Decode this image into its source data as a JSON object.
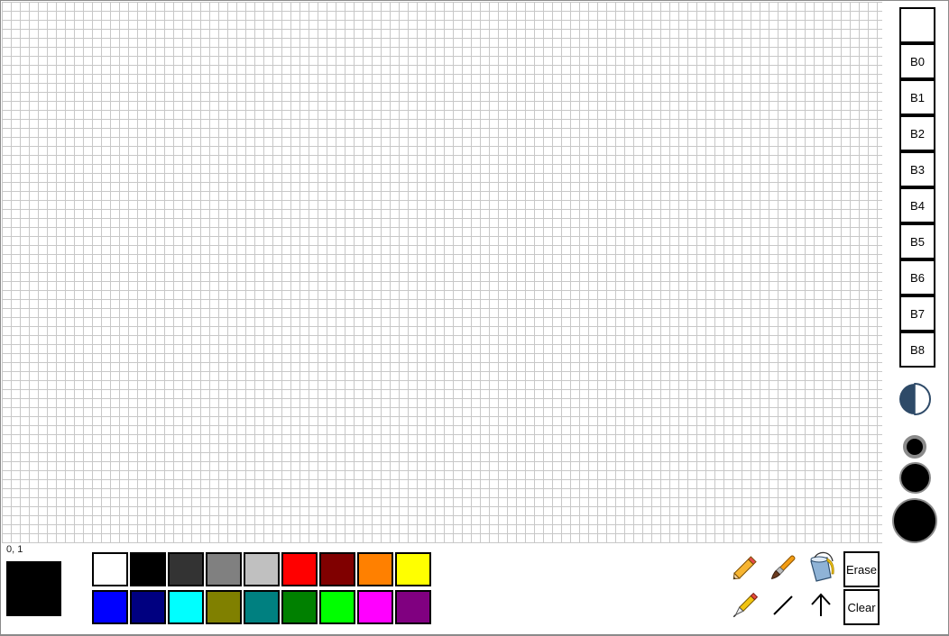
{
  "status": {
    "coords": "0, 1"
  },
  "current_color": "#000000",
  "palette": {
    "row1": [
      "#ffffff",
      "#000000",
      "#333333",
      "#808080",
      "#c0c0c0",
      "#ff0000",
      "#800000",
      "#ff8000",
      "#ffff00"
    ],
    "row2": [
      "#0000ff",
      "#000080",
      "#00ffff",
      "#808000",
      "#008080",
      "#008000",
      "#00ff00",
      "#ff00ff",
      "#800080"
    ]
  },
  "tools": {
    "pencil": "pencil-icon",
    "brush": "brush-icon",
    "bucket": "paint-bucket-icon",
    "pen": "pen-icon",
    "line": "line-icon",
    "arrow": "arrow-up-icon",
    "erase_label": "Erase",
    "clear_label": "Clear"
  },
  "brushes": [
    "",
    "B0",
    "B1",
    "B2",
    "B3",
    "B4",
    "B5",
    "B6",
    "B7",
    "B8"
  ],
  "mode_icon": "contrast-half-icon",
  "sizes": [
    "small",
    "medium",
    "large"
  ]
}
